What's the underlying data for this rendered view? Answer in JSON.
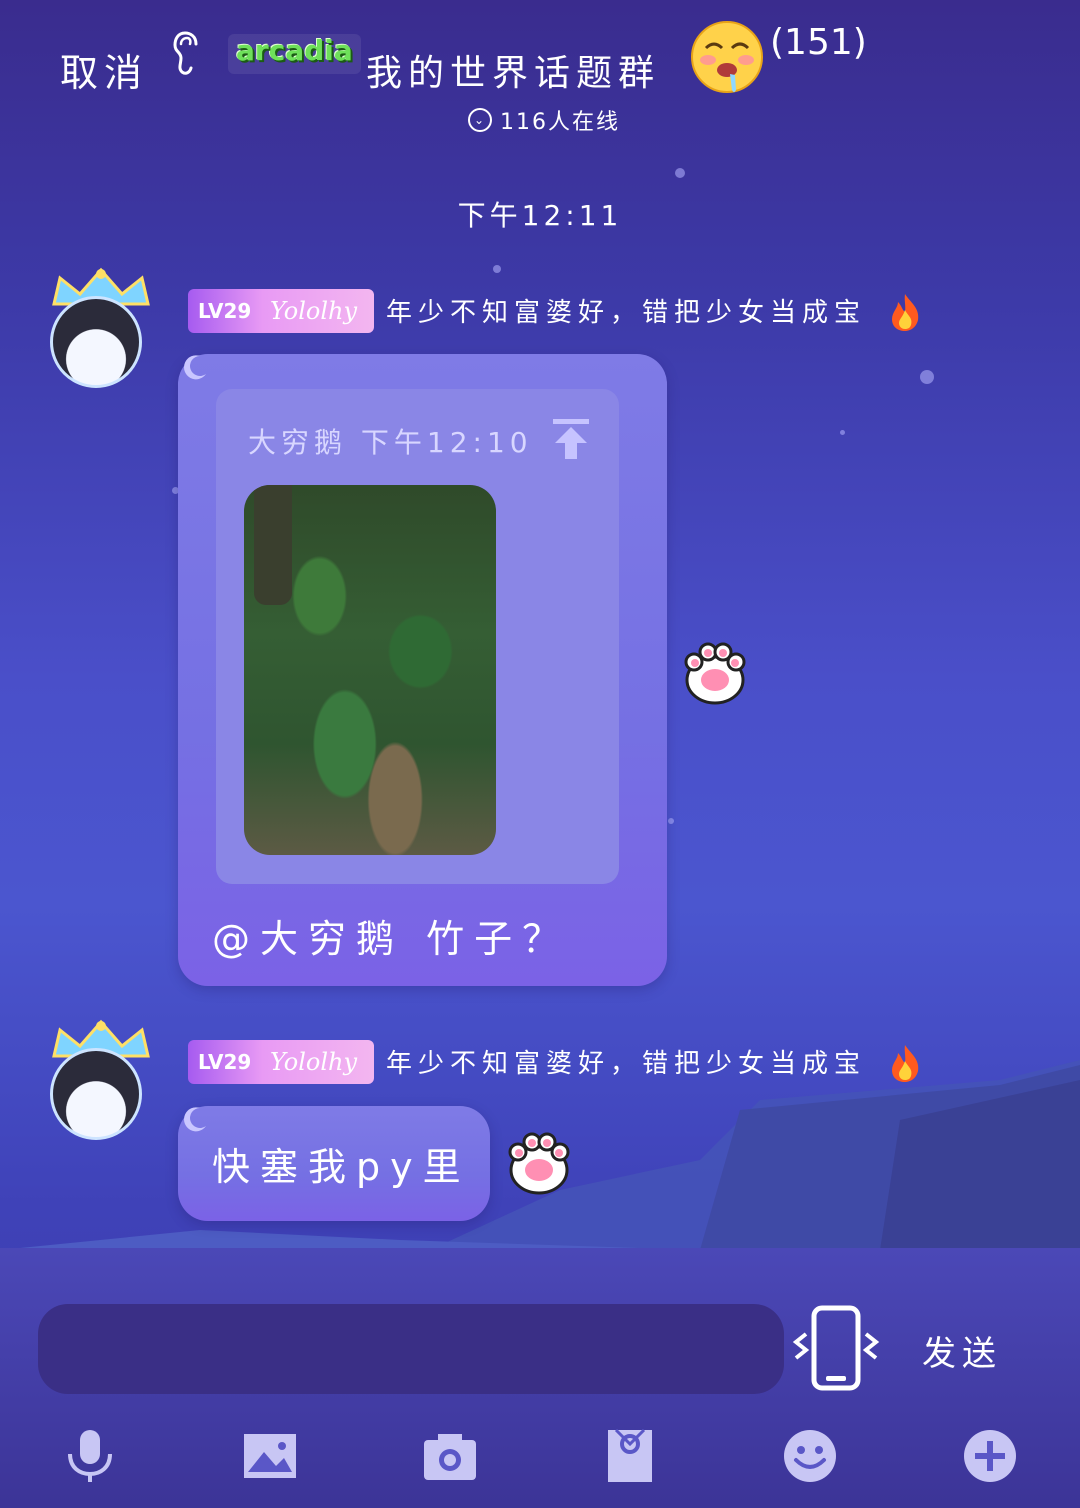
{
  "header": {
    "cancel_label": "取消",
    "logo_text": "arcadia",
    "group_title": "我的世界话题群",
    "member_count": "(151)",
    "online_text": "116人在线"
  },
  "timestamp": "下午12:11",
  "messages": [
    {
      "level": "LV29",
      "username": "Yololhy",
      "signature": "年少不知富婆好，错把少女当成宝",
      "reply": {
        "author_time": "大穷鹅 下午12:10"
      },
      "text": "@大穷鹅 竹子？"
    },
    {
      "level": "LV29",
      "username": "Yololhy",
      "signature": "年少不知富婆好，错把少女当成宝",
      "text": "快塞我py里"
    }
  ],
  "composer": {
    "input_value": "",
    "send_label": "发送"
  },
  "toolbar": [
    "microphone-icon",
    "image-icon",
    "camera-icon",
    "gift-box-icon",
    "emoji-face-icon",
    "plus-icon"
  ],
  "colors": {
    "badge": "#a65bf0",
    "bubble": "#7f7be6",
    "input_bg": "#3a2f86"
  }
}
